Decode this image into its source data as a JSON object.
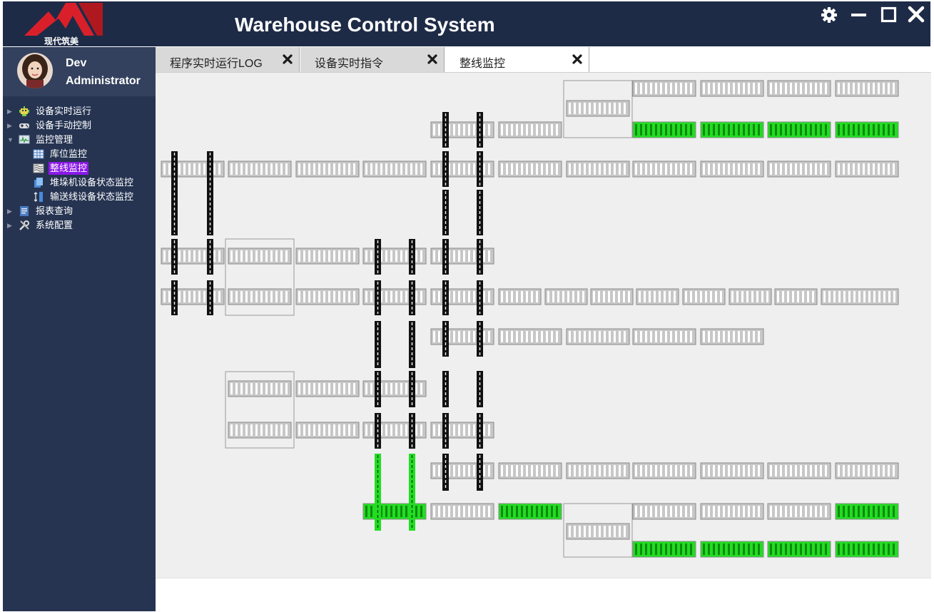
{
  "app": {
    "title": "Warehouse Control System",
    "logo_text": "现代筑美",
    "colors": {
      "header_bg": "#1e2b47",
      "sidebar_bg": "#263452",
      "selected_item": "#8a18e8",
      "logo_red": "#d9202a"
    }
  },
  "window_controls": [
    {
      "name": "settings-icon",
      "icon": "gear"
    },
    {
      "name": "minimize-icon",
      "icon": "minimize"
    },
    {
      "name": "maximize-icon",
      "icon": "maximize"
    },
    {
      "name": "close-icon",
      "icon": "close"
    }
  ],
  "user": {
    "name": "Dev\nAdministrator"
  },
  "nav": [
    {
      "label": "设备实时运行",
      "level": 1,
      "icon": "robot-icon",
      "collapsed": true
    },
    {
      "label": "设备手动控制",
      "level": 1,
      "icon": "gamepad-icon",
      "collapsed": true
    },
    {
      "label": "监控管理",
      "level": 1,
      "icon": "monitor-icon",
      "expanded": true
    },
    {
      "label": "库位监控",
      "level": 2,
      "icon": "grid-icon"
    },
    {
      "label": "整线监控",
      "level": 2,
      "icon": "waves-icon",
      "selected": true
    },
    {
      "label": "堆垛机设备状态监控",
      "level": 2,
      "icon": "stacker-icon"
    },
    {
      "label": "输送线设备状态监控",
      "level": 2,
      "icon": "conveyor-icon"
    },
    {
      "label": "报表查询",
      "level": 1,
      "icon": "report-icon",
      "collapsed": true
    },
    {
      "label": "系统配置",
      "level": 1,
      "icon": "tools-icon",
      "collapsed": true
    }
  ],
  "tabs": [
    {
      "label": "程序实时运行LOG",
      "active": false
    },
    {
      "label": "设备实时指令",
      "active": false
    },
    {
      "label": "整线监控",
      "active": true
    }
  ],
  "line_status": {
    "conveyor_total": 93,
    "conveyors_active": 14,
    "transfer_carts_total": 28,
    "transfer_carts_active": 2,
    "colors": {
      "idle": "#c7c7c7",
      "active": "#22dd22",
      "rail": "#111111"
    }
  }
}
